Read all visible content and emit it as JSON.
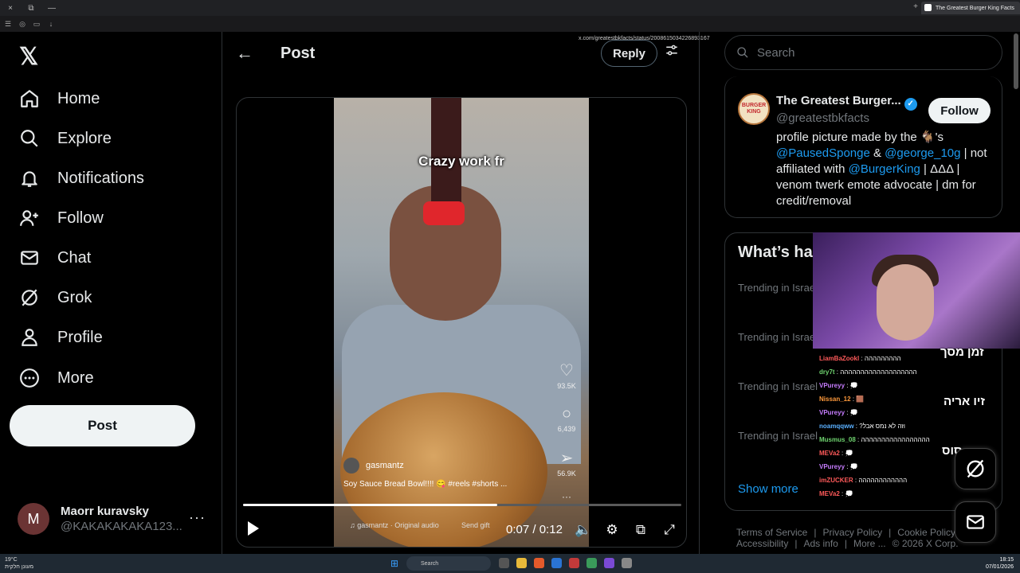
{
  "browser": {
    "tab_title": "The Greatest Burger King Facts",
    "url": "x.com/greatestbkfacts/status/2008615034226893167",
    "new_tab": "+",
    "window_controls": [
      "×",
      "⧉",
      "—"
    ]
  },
  "nav": {
    "logo": "𝕏",
    "items": [
      {
        "label": "Home",
        "icon": "home-icon"
      },
      {
        "label": "Explore",
        "icon": "search-icon"
      },
      {
        "label": "Notifications",
        "icon": "bell-icon"
      },
      {
        "label": "Follow",
        "icon": "follow-icon"
      },
      {
        "label": "Chat",
        "icon": "mail-icon"
      },
      {
        "label": "Grok",
        "icon": "grok-icon"
      },
      {
        "label": "Profile",
        "icon": "profile-icon"
      },
      {
        "label": "More",
        "icon": "more-icon"
      }
    ],
    "post_button": "Post",
    "account": {
      "initial": "M",
      "name": "Maorr kuravsky",
      "handle": "@KAKAKAKAKA123...",
      "more": "···"
    }
  },
  "main": {
    "back": "←",
    "title": "Post",
    "reply_button": "Reply",
    "video": {
      "caption_top": "Crazy work fr",
      "username": "gasmantz",
      "description": "Soy Sauce Bread Bowl!!!! 😋 #reels #shorts ...",
      "audio": "♫ gasmantz · Original audio",
      "gift": "Send gift",
      "likes": "93.5K",
      "comments": "6,439",
      "shares": "56.9K",
      "side_more": "···",
      "time_current": "0:07",
      "time_total": "0:12",
      "progress": 0.58
    }
  },
  "right": {
    "search_placeholder": "Search",
    "profile": {
      "avatar_text": "BURGER KING",
      "name": "The Greatest Burger...",
      "handle": "@greatestbkfacts",
      "follow_button": "Follow",
      "bio_1": "profile picture made by the 🐐's",
      "bio_link_1": "@PausedSponge",
      "bio_amp": " & ",
      "bio_link_2": "@george_10g",
      "bio_2": " | not affiliated with ",
      "bio_link_3": "@BurgerKing",
      "bio_3": " | ΔΔΔ | venom twerk emote advocate | dm for credit/removal"
    },
    "trends": {
      "title": "What’s ha",
      "items": [
        "Trending in Israe",
        "Trending in Israe",
        "Trending in Israel",
        "Trending in Israel"
      ],
      "show_more": "Show more"
    },
    "footer": [
      "Terms of Service",
      "|",
      "Privacy Policy",
      "|",
      "Cookie Policy",
      "|",
      "Accessibility",
      "|",
      "Ads info",
      "|",
      "More ...",
      "© 2026 X Corp."
    ]
  },
  "stream_overlay": {
    "hebrew_1": "זמן מסך",
    "hebrew_2": "זיו אריה",
    "hebrew_3": "סוס",
    "chat": [
      {
        "user": "LiamBaZookl",
        "msg": ": ההההההההה",
        "color": "#ff5a5a"
      },
      {
        "user": "dry7t",
        "msg": ": ההההההההההההההההההה",
        "color": "#6fd36f"
      },
      {
        "user": "VPureyy",
        "msg": ": 💭",
        "color": "#c77dff"
      },
      {
        "user": "Nissan_12",
        "msg": ": 🟫",
        "color": "#ff9a3c"
      },
      {
        "user": "VPureyy",
        "msg": ": 💭",
        "color": "#c77dff"
      },
      {
        "user": "noamqqww",
        "msg": ": ?וזה לא נמס אבל",
        "color": "#5ab0ff"
      },
      {
        "user": "Musmus_08",
        "msg": ": ההההההההההההההההה",
        "color": "#6fd36f"
      },
      {
        "user": "MEVa2",
        "msg": ": 💭",
        "color": "#ff5a5a"
      },
      {
        "user": "VPureyy",
        "msg": ": 💭",
        "color": "#c77dff"
      },
      {
        "user": "imZUCKER",
        "msg": ": הההההההההההה",
        "color": "#ff5a5a"
      },
      {
        "user": "MEVa2",
        "msg": ": 💭",
        "color": "#ff5a5a"
      }
    ]
  },
  "taskbar": {
    "weather": "19°C",
    "weather_sub": "מעונן חלקית",
    "search": "Search",
    "time": "18:15",
    "date": "07/01/2026"
  }
}
